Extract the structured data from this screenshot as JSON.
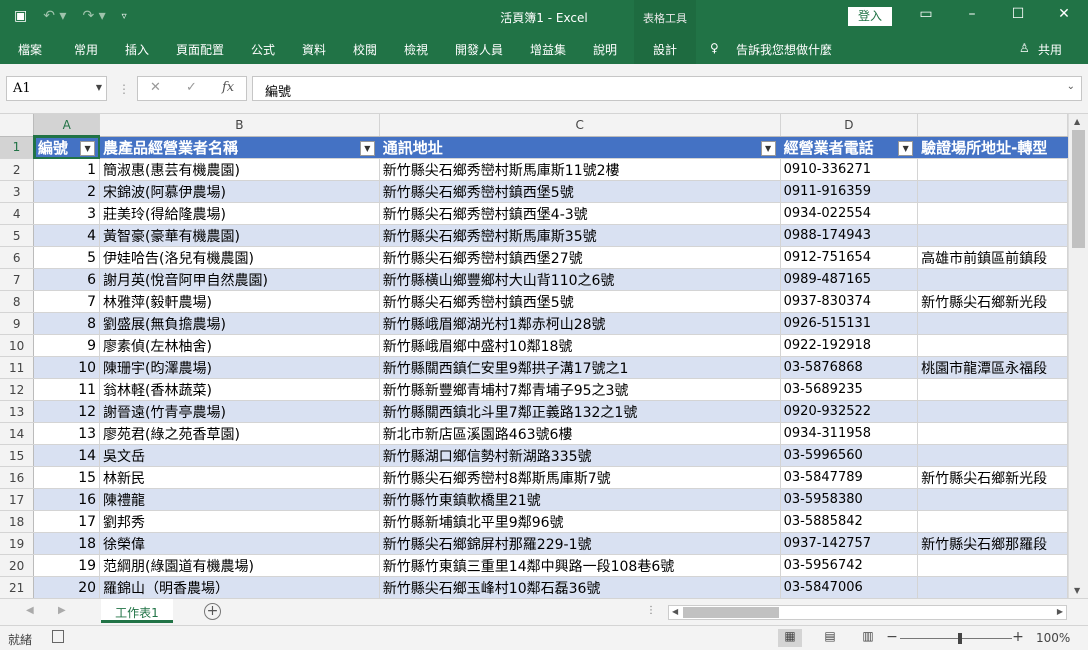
{
  "window": {
    "title": "活頁簿1 - Excel",
    "tool_tab": "表格工具",
    "login": "登入"
  },
  "ribbon": {
    "tabs": [
      "檔案",
      "常用",
      "插入",
      "頁面配置",
      "公式",
      "資料",
      "校閱",
      "檢視",
      "開發人員",
      "增益集",
      "說明",
      "設計"
    ],
    "active": "設計",
    "tell_me": "告訴我您想做什麼",
    "share": "共用"
  },
  "formula_bar": {
    "name_box": "A1",
    "content": "編號",
    "fx": "fx"
  },
  "columns": [
    "A",
    "B",
    "C",
    "D",
    ""
  ],
  "headers": [
    "編號",
    "農產品經營業者名稱",
    "通訊地址",
    "經營業者電話",
    "驗證場所地址-轉型"
  ],
  "rows": [
    {
      "n": "1",
      "name": "簡淑惠(惠芸有機農園)",
      "addr": "新竹縣尖石鄉秀巒村斯馬庫斯11號2樓",
      "tel": "0910-336271",
      "site": ""
    },
    {
      "n": "2",
      "name": "宋錦波(阿慕伊農場)",
      "addr": "新竹縣尖石鄉秀巒村鎮西堡5號",
      "tel": "0911-916359",
      "site": ""
    },
    {
      "n": "3",
      "name": "莊美玲(得給隆農場)",
      "addr": "新竹縣尖石鄉秀巒村鎮西堡4-3號",
      "tel": "0934-022554",
      "site": ""
    },
    {
      "n": "4",
      "name": "黃智豪(豪華有機農園)",
      "addr": "新竹縣尖石鄉秀巒村斯馬庫斯35號",
      "tel": "0988-174943",
      "site": ""
    },
    {
      "n": "5",
      "name": "伊娃哈告(洛兒有機農園)",
      "addr": "新竹縣尖石鄉秀巒村鎮西堡27號",
      "tel": "0912-751654",
      "site": "高雄市前鎮區前鎮段"
    },
    {
      "n": "6",
      "name": "謝月英(悅音阿甲自然農園)",
      "addr": "新竹縣橫山鄉豐鄉村大山背110之6號",
      "tel": "0989-487165",
      "site": ""
    },
    {
      "n": "7",
      "name": "林雅萍(毅軒農場)",
      "addr": "新竹縣尖石鄉秀巒村鎮西堡5號",
      "tel": "0937-830374",
      "site": "新竹縣尖石鄉新光段"
    },
    {
      "n": "8",
      "name": "劉盛展(無負擔農場)",
      "addr": "新竹縣峨眉鄉湖光村1鄰赤柯山28號",
      "tel": "0926-515131",
      "site": ""
    },
    {
      "n": "9",
      "name": "廖素偵(左林柚舍)",
      "addr": "新竹縣峨眉鄉中盛村10鄰18號",
      "tel": "0922-192918",
      "site": ""
    },
    {
      "n": "10",
      "name": "陳珊宇(昀澤農場)",
      "addr": "新竹縣關西鎮仁安里9鄰拱子溝17號之1",
      "tel": "03-5876868",
      "site": "桃園市龍潭區永福段"
    },
    {
      "n": "11",
      "name": "翁林軽(香林蔬菜)",
      "addr": "新竹縣新豐鄉青埔村7鄰青埔子95之3號",
      "tel": "03-5689235",
      "site": ""
    },
    {
      "n": "12",
      "name": "謝晉遠(竹青亭農場)",
      "addr": "新竹縣關西鎮北斗里7鄰正義路132之1號",
      "tel": "0920-932522",
      "site": ""
    },
    {
      "n": "13",
      "name": "廖苑君(綠之苑香草園)",
      "addr": "新北市新店區溪園路463號6樓",
      "tel": "0934-311958",
      "site": ""
    },
    {
      "n": "14",
      "name": "吳文岳",
      "addr": "新竹縣湖口鄉信勢村新湖路335號",
      "tel": "03-5996560",
      "site": ""
    },
    {
      "n": "15",
      "name": "林新民",
      "addr": "新竹縣尖石鄉秀巒村8鄰斯馬庫斯7號",
      "tel": "03-5847789",
      "site": "新竹縣尖石鄉新光段"
    },
    {
      "n": "16",
      "name": "陳禮龍",
      "addr": "新竹縣竹東鎮軟橋里21號",
      "tel": "03-5958380",
      "site": ""
    },
    {
      "n": "17",
      "name": "劉邦秀",
      "addr": "新竹縣新埔鎮北平里9鄰96號",
      "tel": "03-5885842",
      "site": ""
    },
    {
      "n": "18",
      "name": "徐榮偉",
      "addr": "新竹縣尖石鄉錦屏村那羅229-1號",
      "tel": "0937-142757",
      "site": "新竹縣尖石鄉那羅段"
    },
    {
      "n": "19",
      "name": "范綱朋(綠園道有機農場)",
      "addr": "新竹縣竹東鎮三重里14鄰中興路一段108巷6號",
      "tel": "03-5956742",
      "site": ""
    },
    {
      "n": "20",
      "name": "羅錦山（明香農場）",
      "addr": "新竹縣尖石鄉玉峰村10鄰石磊36號",
      "tel": "03-5847006",
      "site": ""
    }
  ],
  "sheet_tab": "工作表1",
  "status": {
    "ready": "就緒",
    "zoom": "100%"
  }
}
